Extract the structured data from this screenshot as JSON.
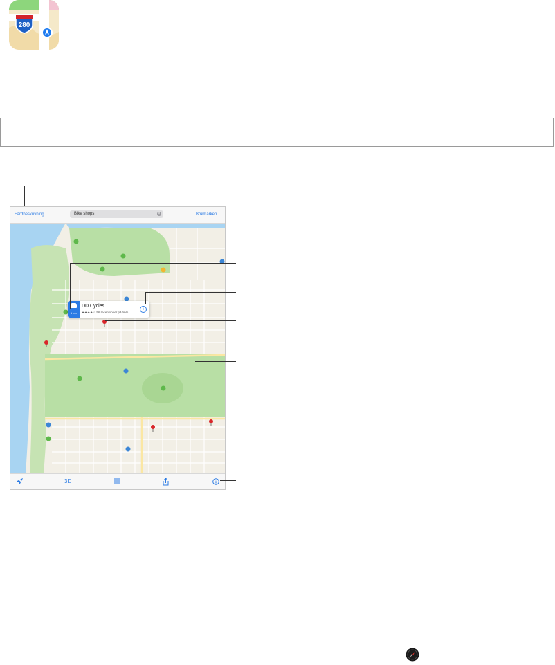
{
  "top_bar": {
    "directions_label": "Färdbeskrivning",
    "search_value": "Bike shops",
    "bookmarks_label": "Bokmärken"
  },
  "popup": {
    "name": "DD Cycles",
    "rating_text": "★★★★☆ 56 recensioner på Yelp",
    "drive_time": "1 min"
  },
  "bottom_bar": {
    "location_icon": "location-arrow-icon",
    "three_d_label": "3D",
    "list_icon": "list-icon",
    "share_icon": "share-icon",
    "info_icon": "info-icon"
  },
  "colors": {
    "accent": "#2b7be4",
    "water": "#a8d4f2",
    "park": "#b8dfa5",
    "road": "#ffffff",
    "block": "#f2efe6",
    "pin": "#d9262a"
  }
}
